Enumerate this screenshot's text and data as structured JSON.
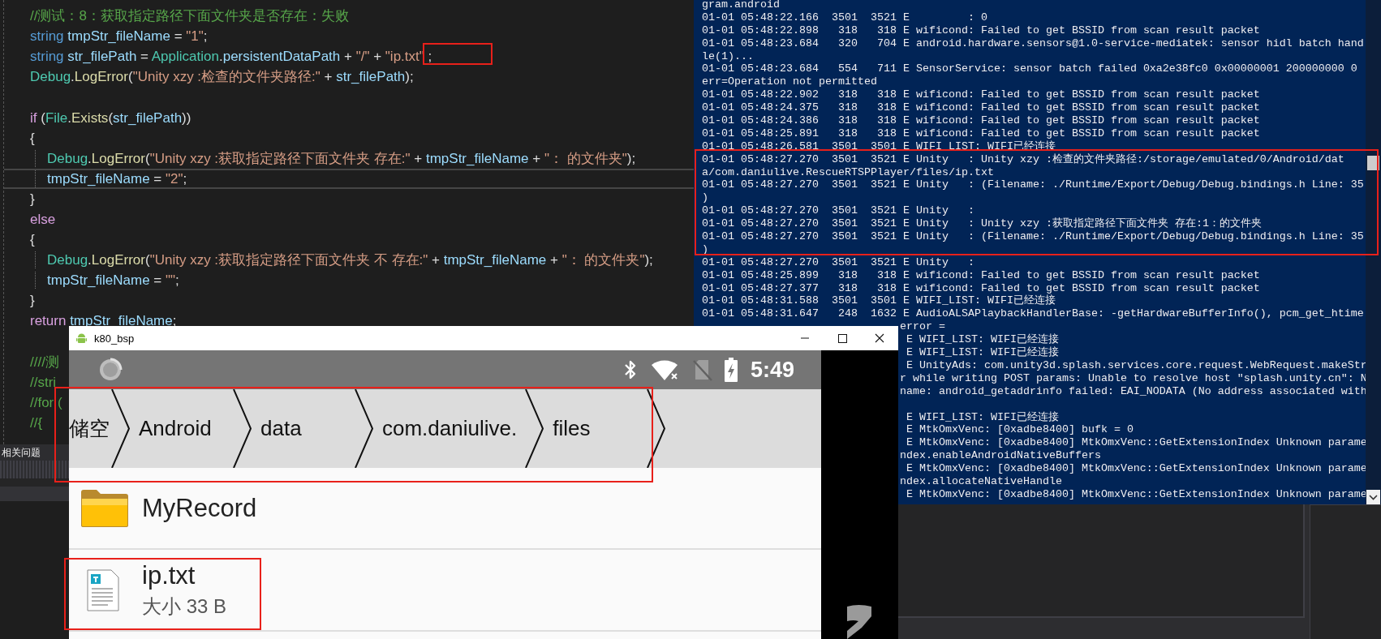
{
  "editor": {
    "lines": [
      {
        "kind": "code",
        "indented": false,
        "current": false,
        "tokens": [
          {
            "text": "//测试：8：获取指定路径下面文件夹是否存在：失败",
            "kind": "comment"
          }
        ]
      },
      {
        "kind": "code",
        "indented": false,
        "current": false,
        "tokens": [
          {
            "text": "string ",
            "kind": "keyword"
          },
          {
            "text": "tmpStr_fileName",
            "kind": "ident"
          },
          {
            "text": " = ",
            "kind": "plain"
          },
          {
            "text": "\"1\"",
            "kind": "string"
          },
          {
            "text": ";",
            "kind": "plain"
          }
        ]
      },
      {
        "kind": "code",
        "indented": false,
        "current": false,
        "tokens": [
          {
            "text": "string ",
            "kind": "keyword"
          },
          {
            "text": "str_filePath",
            "kind": "ident"
          },
          {
            "text": " = ",
            "kind": "plain"
          },
          {
            "text": "Application",
            "kind": "type"
          },
          {
            "text": ".",
            "kind": "plain"
          },
          {
            "text": "persistentDataPath",
            "kind": "ident"
          },
          {
            "text": " + ",
            "kind": "plain"
          },
          {
            "text": "\"/\"",
            "kind": "string"
          },
          {
            "text": " + ",
            "kind": "plain"
          },
          {
            "text": "\"ip.txt\"",
            "kind": "string"
          },
          {
            "text": " ;",
            "kind": "plain"
          }
        ]
      },
      {
        "kind": "code",
        "indented": false,
        "current": false,
        "tokens": [
          {
            "text": "Debug",
            "kind": "type"
          },
          {
            "text": ".",
            "kind": "plain"
          },
          {
            "text": "LogError",
            "kind": "method"
          },
          {
            "text": "(",
            "kind": "plain"
          },
          {
            "text": "\"Unity xzy :检查的文件夹路径:\"",
            "kind": "string"
          },
          {
            "text": " + ",
            "kind": "plain"
          },
          {
            "text": "str_filePath",
            "kind": "ident"
          },
          {
            "text": ");",
            "kind": "plain"
          }
        ]
      },
      {
        "kind": "blank"
      },
      {
        "kind": "code",
        "indented": false,
        "current": false,
        "tokens": [
          {
            "text": "if",
            "kind": "control"
          },
          {
            "text": " (",
            "kind": "plain"
          },
          {
            "text": "File",
            "kind": "type"
          },
          {
            "text": ".",
            "kind": "plain"
          },
          {
            "text": "Exists",
            "kind": "method"
          },
          {
            "text": "(",
            "kind": "plain"
          },
          {
            "text": "str_filePath",
            "kind": "ident"
          },
          {
            "text": "))",
            "kind": "plain"
          }
        ]
      },
      {
        "kind": "code",
        "indented": false,
        "current": false,
        "tokens": [
          {
            "text": "{",
            "kind": "plain"
          }
        ]
      },
      {
        "kind": "code",
        "indented": true,
        "current": false,
        "tokens": [
          {
            "text": "Debug",
            "kind": "type"
          },
          {
            "text": ".",
            "kind": "plain"
          },
          {
            "text": "LogError",
            "kind": "method"
          },
          {
            "text": "(",
            "kind": "plain"
          },
          {
            "text": "\"Unity xzy :获取指定路径下面文件夹 存在:\"",
            "kind": "string"
          },
          {
            "text": " + ",
            "kind": "plain"
          },
          {
            "text": "tmpStr_fileName",
            "kind": "ident"
          },
          {
            "text": " + ",
            "kind": "plain"
          },
          {
            "text": "\"： 的文件夹\"",
            "kind": "string"
          },
          {
            "text": ");",
            "kind": "plain"
          }
        ]
      },
      {
        "kind": "code",
        "indented": true,
        "current": true,
        "tokens": [
          {
            "text": "tmpStr_fileName",
            "kind": "ident"
          },
          {
            "text": " = ",
            "kind": "plain"
          },
          {
            "text": "\"2\"",
            "kind": "string"
          },
          {
            "text": ";",
            "kind": "plain"
          }
        ]
      },
      {
        "kind": "code",
        "indented": false,
        "current": false,
        "tokens": [
          {
            "text": "}",
            "kind": "plain"
          }
        ]
      },
      {
        "kind": "code",
        "indented": false,
        "current": false,
        "tokens": [
          {
            "text": "else",
            "kind": "control"
          }
        ]
      },
      {
        "kind": "code",
        "indented": false,
        "current": false,
        "tokens": [
          {
            "text": "{",
            "kind": "plain"
          }
        ]
      },
      {
        "kind": "code",
        "indented": true,
        "current": false,
        "tokens": [
          {
            "text": "Debug",
            "kind": "type"
          },
          {
            "text": ".",
            "kind": "plain"
          },
          {
            "text": "LogError",
            "kind": "method"
          },
          {
            "text": "(",
            "kind": "plain"
          },
          {
            "text": "\"Unity xzy :获取指定路径下面文件夹 不 存在:\"",
            "kind": "string"
          },
          {
            "text": " + ",
            "kind": "plain"
          },
          {
            "text": "tmpStr_fileName",
            "kind": "ident"
          },
          {
            "text": " + ",
            "kind": "plain"
          },
          {
            "text": "\"： 的文件夹\"",
            "kind": "string"
          },
          {
            "text": ");",
            "kind": "plain"
          }
        ]
      },
      {
        "kind": "code",
        "indented": true,
        "current": false,
        "tokens": [
          {
            "text": "tmpStr_fileName",
            "kind": "ident"
          },
          {
            "text": " = ",
            "kind": "plain"
          },
          {
            "text": "\"\"",
            "kind": "string"
          },
          {
            "text": ";",
            "kind": "plain"
          }
        ]
      },
      {
        "kind": "code",
        "indented": false,
        "current": false,
        "tokens": [
          {
            "text": "}",
            "kind": "plain"
          }
        ]
      },
      {
        "kind": "code",
        "indented": false,
        "current": false,
        "tokens": [
          {
            "text": "return ",
            "kind": "control"
          },
          {
            "text": "tmpStr_fileName",
            "kind": "ident"
          },
          {
            "text": ";",
            "kind": "plain"
          }
        ]
      },
      {
        "kind": "blank"
      },
      {
        "kind": "code",
        "indented": false,
        "current": false,
        "tokens": [
          {
            "text": "////测",
            "kind": "comment"
          }
        ]
      },
      {
        "kind": "code",
        "indented": false,
        "current": false,
        "tokens": [
          {
            "text": "//stri",
            "kind": "comment"
          }
        ]
      },
      {
        "kind": "code",
        "indented": false,
        "current": false,
        "tokens": [
          {
            "text": "//for (",
            "kind": "comment"
          }
        ]
      },
      {
        "kind": "code",
        "indented": false,
        "current": false,
        "tokens": [
          {
            "text": "//{",
            "kind": "comment"
          }
        ]
      }
    ],
    "panel_tab": "相关问题"
  },
  "console": {
    "lines": [
      {
        "kind": "full",
        "text": "gram.android"
      },
      {
        "kind": "full",
        "text": "01-01 05:48:22.166  3501  3521 E         : 0"
      },
      {
        "kind": "full",
        "text": "01-01 05:48:22.898   318   318 E wificond: Failed to get BSSID from scan result packet"
      },
      {
        "kind": "full",
        "text": "01-01 05:48:23.684   320   704 E android.hardware.sensors@1.0-service-mediatek: sensor hidl batch hand"
      },
      {
        "kind": "full",
        "text": "le(1)..."
      },
      {
        "kind": "full",
        "text": "01-01 05:48:23.684   554   711 E SensorService: sensor batch failed 0xa2e38fc0 0x00000001 200000000 0"
      },
      {
        "kind": "full",
        "text": "err=Operation not permitted"
      },
      {
        "kind": "full",
        "text": "01-01 05:48:22.902   318   318 E wificond: Failed to get BSSID from scan result packet"
      },
      {
        "kind": "full",
        "text": "01-01 05:48:24.375   318   318 E wificond: Failed to get BSSID from scan result packet"
      },
      {
        "kind": "full",
        "text": "01-01 05:48:24.386   318   318 E wificond: Failed to get BSSID from scan result packet"
      },
      {
        "kind": "full",
        "text": "01-01 05:48:25.891   318   318 E wificond: Failed to get BSSID from scan result packet"
      },
      {
        "kind": "full",
        "text": "01-01 05:48:26.581  3501  3501 E WIFI_LIST: WIFI已经连接"
      },
      {
        "kind": "full",
        "text": "01-01 05:48:27.270  3501  3521 E Unity   : Unity xzy :检查的文件夹路径:/storage/emulated/0/Android/dat"
      },
      {
        "kind": "full",
        "text": "a/com.daniulive.RescueRTSPPlayer/files/ip.txt"
      },
      {
        "kind": "full",
        "text": "01-01 05:48:27.270  3501  3521 E Unity   : (Filename: ./Runtime/Export/Debug/Debug.bindings.h Line: 35"
      },
      {
        "kind": "full",
        "text": ")"
      },
      {
        "kind": "full",
        "text": "01-01 05:48:27.270  3501  3521 E Unity   :"
      },
      {
        "kind": "full",
        "text": "01-01 05:48:27.270  3501  3521 E Unity   : Unity xzy :获取指定路径下面文件夹 存在:1：的文件夹"
      },
      {
        "kind": "full",
        "text": "01-01 05:48:27.270  3501  3521 E Unity   : (Filename: ./Runtime/Export/Debug/Debug.bindings.h Line: 35"
      },
      {
        "kind": "full",
        "text": ")"
      },
      {
        "kind": "full",
        "text": "01-01 05:48:27.270  3501  3521 E Unity   :"
      },
      {
        "kind": "full",
        "text": "01-01 05:48:25.899   318   318 E wificond: Failed to get BSSID from scan result packet"
      },
      {
        "kind": "full",
        "text": "01-01 05:48:27.377   318   318 E wificond: Failed to get BSSID from scan result packet"
      },
      {
        "kind": "full",
        "text": "01-01 05:48:31.588  3501  3501 E WIFI_LIST: WIFI已经连接"
      },
      {
        "kind": "full",
        "text": "01-01 05:48:31.647   248  1632 E AudioALSAPlaybackHandlerBase: -getHardwareBufferInfo(), pcm_get_htime"
      },
      {
        "kind": "cont",
        "text": "error ="
      },
      {
        "kind": "tail",
        "text": "E WIFI_LIST: WIFI已经连接"
      },
      {
        "kind": "tail",
        "text": "E WIFI_LIST: WIFI已经连接"
      },
      {
        "kind": "tail",
        "text": "E UnityAds: com.unity3d.splash.services.core.request.WebRequest.makeStr"
      },
      {
        "kind": "cont",
        "text": "r while writing POST params: Unable to resolve host \"splash.unity.cn\": N"
      },
      {
        "kind": "cont",
        "text": "name: android_getaddrinfo failed: EAI_NODATA (No address associated with"
      },
      {
        "kind": "blank"
      },
      {
        "kind": "tail",
        "text": "E WIFI_LIST: WIFI已经连接"
      },
      {
        "kind": "tail",
        "text": "E MtkOmxVenc: [0xadbe8400] bufk = 0"
      },
      {
        "kind": "tail",
        "text": "E MtkOmxVenc: [0xadbe8400] MtkOmxVenc::GetExtensionIndex Unknown parame"
      },
      {
        "kind": "cont",
        "text": "ndex.enableAndroidNativeBuffers"
      },
      {
        "kind": "tail",
        "text": "E MtkOmxVenc: [0xadbe8400] MtkOmxVenc::GetExtensionIndex Unknown parame"
      },
      {
        "kind": "cont",
        "text": "ndex.allocateNativeHandle"
      },
      {
        "kind": "tail",
        "text": "E MtkOmxVenc: [0xadbe8400] MtkOmxVenc::GetExtensionIndex Unknown parame"
      }
    ]
  },
  "emulator": {
    "title": "k80_bsp",
    "status_bar": {
      "time": "5:49"
    },
    "breadcrumbs": [
      {
        "label": "储空"
      },
      {
        "label": "Android"
      },
      {
        "label": "data"
      },
      {
        "label": "com.daniulive."
      },
      {
        "label": "files"
      }
    ],
    "files": [
      {
        "kind": "folder",
        "name": "MyRecord"
      },
      {
        "kind": "text",
        "name": "ip.txt",
        "detail": "大小 33 B"
      }
    ]
  }
}
